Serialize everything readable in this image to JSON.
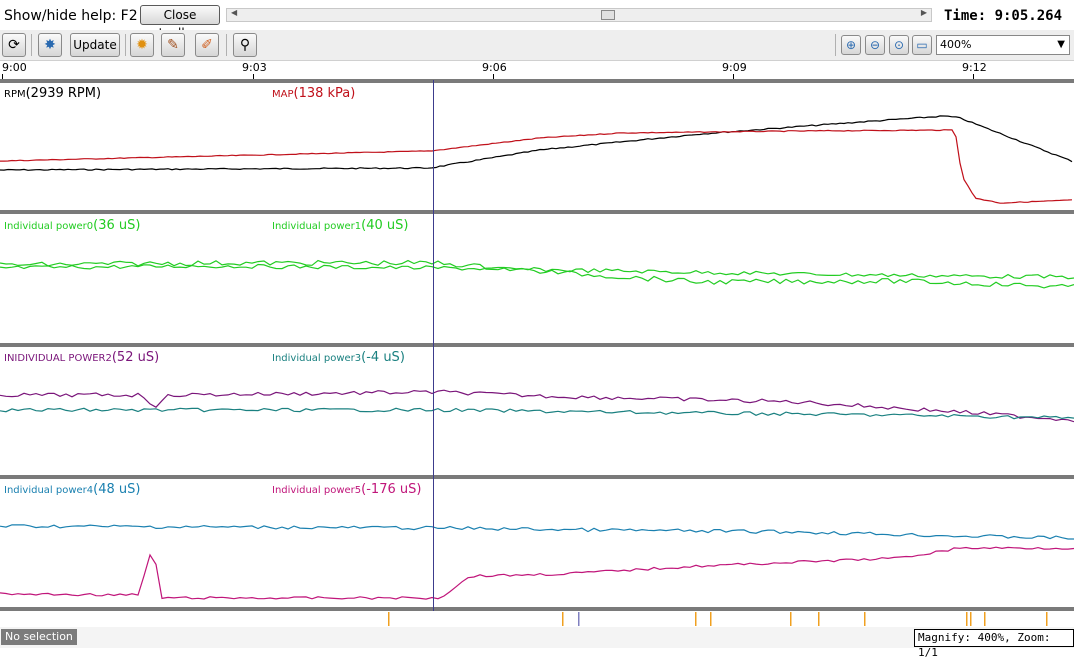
{
  "header": {
    "help_text": "Show/hide help: F2",
    "close_toolbar_label": "Close toolbar",
    "time_readout": "Time: 9:05.264"
  },
  "toolbar": {
    "update_label": "Update",
    "zoom_value": "400%",
    "icons": [
      "refresh-icon",
      "gauge-icon",
      "settings-icon",
      "chart-edit-icon",
      "paint-icon",
      "search-icon",
      "zoom-in-icon",
      "zoom-out-icon",
      "zoom-fit-icon",
      "window-icon"
    ]
  },
  "time_axis": {
    "ticks": [
      "9:00",
      "9:03",
      "9:06",
      "9:09",
      "9:12"
    ]
  },
  "panels": [
    {
      "channels": [
        {
          "name": "RPM",
          "value": "(2939 RPM)",
          "color": "#000000"
        },
        {
          "name": "MAP",
          "value": "(138 kPa)",
          "color": "#c0101a"
        }
      ]
    },
    {
      "channels": [
        {
          "name": "Individual power0",
          "value": "(36 uS)",
          "color": "#22cc22"
        },
        {
          "name": "Individual power1",
          "value": "(40 uS)",
          "color": "#22cc22"
        }
      ]
    },
    {
      "channels": [
        {
          "name": "INIDIVIDUAL POWER2",
          "value": "(52 uS)",
          "color": "#7a157a"
        },
        {
          "name": "Individual power3",
          "value": "(-4 uS)",
          "color": "#1a8080"
        }
      ]
    },
    {
      "channels": [
        {
          "name": "Individual power4",
          "value": "(48 uS)",
          "color": "#1a80b0"
        },
        {
          "name": "Individual power5",
          "value": "(-176 uS)",
          "color": "#c0157a"
        }
      ]
    }
  ],
  "event_marker_color": "#f0a020",
  "status": {
    "selection": "No selection",
    "magnify": "Magnify: 400%, Zoom: 1/1"
  }
}
